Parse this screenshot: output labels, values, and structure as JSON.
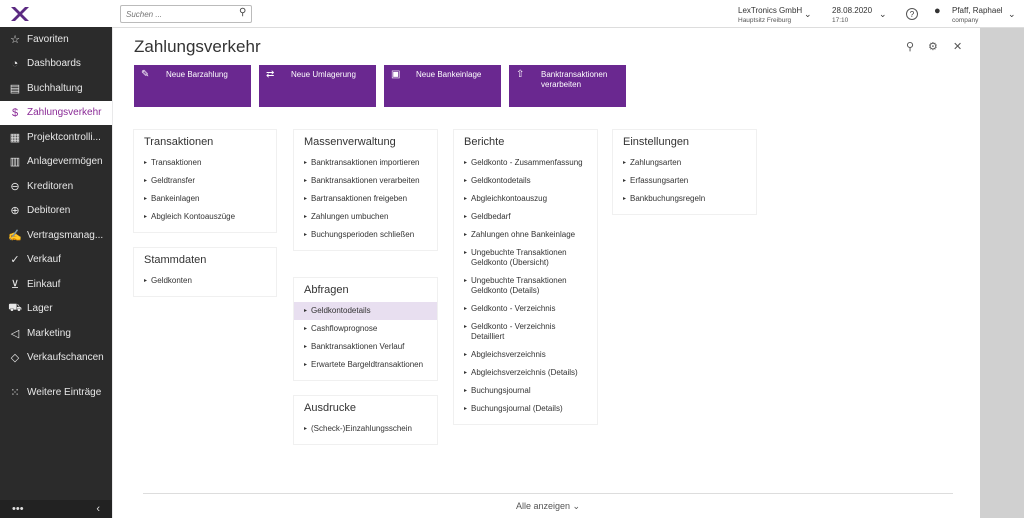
{
  "search": {
    "placeholder": "Suchen ..."
  },
  "topbar": {
    "company": "LexTronics GmbH",
    "site": "Hauptsitz Freiburg",
    "date": "28.08.2020",
    "time": "17:10",
    "user": "Pfaff, Raphael",
    "role": "company"
  },
  "sidebar": {
    "items": [
      {
        "label": "Favoriten",
        "icon": "star-icon"
      },
      {
        "label": "Dashboards",
        "icon": "gauge-icon"
      },
      {
        "label": "Buchhaltung",
        "icon": "book-icon"
      },
      {
        "label": "Zahlungsverkehr",
        "icon": "dollar-icon"
      },
      {
        "label": "Projektcontrolli...",
        "icon": "project-icon"
      },
      {
        "label": "Anlagevermögen",
        "icon": "building-icon"
      },
      {
        "label": "Kreditoren",
        "icon": "minus-circle-icon"
      },
      {
        "label": "Debitoren",
        "icon": "plus-circle-icon"
      },
      {
        "label": "Vertragsmanag...",
        "icon": "handshake-icon"
      },
      {
        "label": "Verkauf",
        "icon": "sale-icon"
      },
      {
        "label": "Einkauf",
        "icon": "cart-icon"
      },
      {
        "label": "Lager",
        "icon": "truck-icon"
      },
      {
        "label": "Marketing",
        "icon": "megaphone-icon"
      },
      {
        "label": "Verkaufschancen",
        "icon": "tag-icon"
      },
      {
        "label": "Weitere Einträge",
        "icon": "grid-icon"
      }
    ],
    "footer_dots": "•••",
    "collapse": "‹"
  },
  "page": {
    "title": "Zahlungsverkehr",
    "show_all": "Alle anzeigen ⌄"
  },
  "tiles": [
    {
      "label": "Neue Barzahlung",
      "icon": "edit-icon"
    },
    {
      "label": "Neue Umlagerung",
      "icon": "transfer-icon"
    },
    {
      "label": "Neue Bankeinlage",
      "icon": "deposit-icon"
    },
    {
      "label": "Banktransaktionen verarbeiten",
      "icon": "upload-icon"
    }
  ],
  "transaktionen": {
    "title": "Transaktionen",
    "items": [
      "Transaktionen",
      "Geldtransfer",
      "Bankeinlagen",
      "Abgleich Kontoauszüge"
    ]
  },
  "stammdaten": {
    "title": "Stammdaten",
    "items": [
      "Geldkonten"
    ]
  },
  "massenverwaltung": {
    "title": "Massenverwaltung",
    "items": [
      "Banktransaktionen importieren",
      "Banktransaktionen verarbeiten",
      "Bartransaktionen freigeben",
      "Zahlungen umbuchen",
      "Buchungsperioden schließen"
    ]
  },
  "abfragen": {
    "title": "Abfragen",
    "items": [
      "Geldkontodetails",
      "Cashflowprognose",
      "Banktransaktionen Verlauf",
      "Erwartete Bargeldtransaktionen"
    ]
  },
  "ausdrucke": {
    "title": "Ausdrucke",
    "items": [
      "(Scheck-)Einzahlungsschein"
    ]
  },
  "berichte": {
    "title": "Berichte",
    "items": [
      "Geldkonto - Zusammenfassung",
      "Geldkontodetails",
      "Abgleichkontoauszug",
      "Geldbedarf",
      "Zahlungen ohne Bankeinlage",
      "Ungebuchte Transaktionen Geldkonto (Übersicht)",
      "Ungebuchte Transaktionen Geldkonto (Details)",
      "Geldkonto - Verzeichnis",
      "Geldkonto - Verzeichnis Detailliert",
      "Abgleichsverzeichnis",
      "Abgleichsverzeichnis (Details)",
      "Buchungsjournal",
      "Buchungsjournal (Details)"
    ]
  },
  "einstellungen": {
    "title": "Einstellungen",
    "items": [
      "Zahlungsarten",
      "Erfassungsarten",
      "Bankbuchungsregeln"
    ]
  }
}
